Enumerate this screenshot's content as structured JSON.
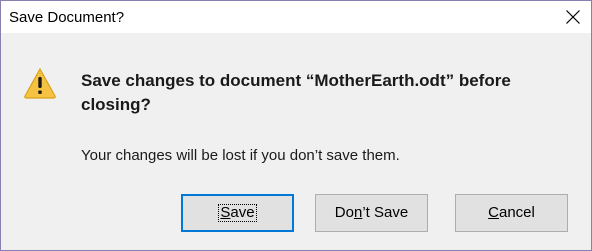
{
  "window": {
    "title": "Save Document?",
    "close_symbol": "close-icon"
  },
  "content": {
    "icon": "warning-icon",
    "heading": "Save changes to document “MotherEarth.odt” before closing?",
    "message": "Your changes will be lost if you don’t save them."
  },
  "buttons": {
    "save": {
      "prefix": "",
      "mnemonic": "S",
      "suffix": "ave",
      "focused": true
    },
    "dont_save": {
      "prefix": "Do",
      "mnemonic": "n",
      "suffix": "’t Save"
    },
    "cancel": {
      "prefix": "",
      "mnemonic": "C",
      "suffix": "ancel"
    }
  },
  "colors": {
    "accent": "#0078d7",
    "warning_fill": "#f5c242",
    "warning_outline": "#d9a21b"
  }
}
